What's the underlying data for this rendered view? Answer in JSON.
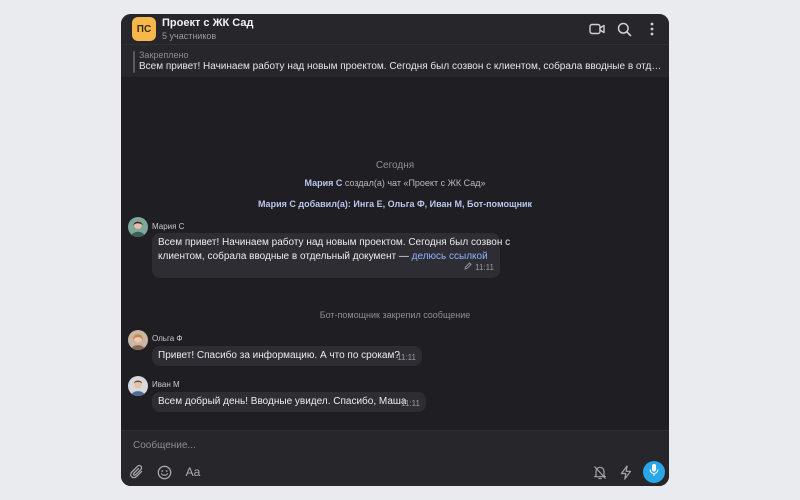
{
  "header": {
    "avatar_initials": "ПС",
    "title": "Проект с ЖК Сад",
    "subtitle": "5 участников"
  },
  "pinned": {
    "label": "Закреплено",
    "text": "Всем привет! Начинаем работу над новым проектом. Сегодня был созвон с клиентом, собрала вводные в отдельный документ — делюсь ссылкой"
  },
  "feed": {
    "date": "Сегодня",
    "system1": {
      "actor": "Мария С",
      "text": " создал(а) чат «Проект с ЖК Сад»"
    },
    "system2": {
      "actor": "Мария С",
      "text": " добавил(а): ",
      "added": "Инга Е, Ольга Ф, Иван М, Бот-помощник"
    },
    "system3": "Бот-помощник закрепил сообщение"
  },
  "messages": [
    {
      "sender": "Мария С",
      "line1": "Всем привет! Начинаем работу над новым проектом. Сегодня был созвон с",
      "line2": "клиентом, собрала вводные в отдельный документ — ",
      "link": "делюсь ссылкой",
      "time": "11:11"
    },
    {
      "sender": "Ольга Ф",
      "text": "Привет! Спасибо за информацию. А что по срокам?",
      "time": "11:11"
    },
    {
      "sender": "Иван М",
      "text": "Всем добрый день! Вводные увидел. Спасибо, Маша",
      "time": "11:11"
    }
  ],
  "composer": {
    "placeholder": "Сообщение...",
    "format_label": "Aa"
  },
  "colors": {
    "accent": "#2aa7e8",
    "chat_avatar": "#f6b84b",
    "link": "#8fb3ff",
    "background": "#1f1f23"
  }
}
